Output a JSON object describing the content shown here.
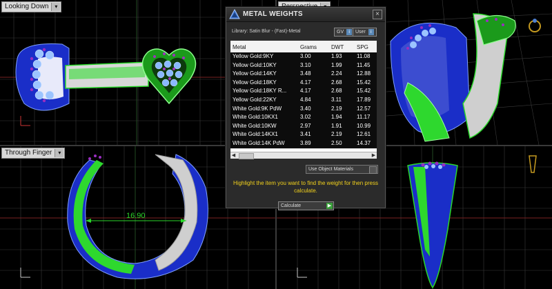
{
  "viewports": {
    "top_left": {
      "label": "Looking Down"
    },
    "top_right": {
      "label": "Perspective"
    },
    "bottom_left": {
      "label": "Through Finger",
      "dimension": "16.90"
    },
    "bottom_right": {
      "label": ""
    }
  },
  "dialog": {
    "title": "METAL WEIGHTS",
    "close": "×",
    "library": "Library: Satin Blur - (Fast)-Metal",
    "toggle_gv": "GV",
    "toggle_user": "User",
    "toggle_mark": "i",
    "columns": [
      "Metal",
      "Grams",
      "DWT",
      "SPG"
    ],
    "rows": [
      {
        "metal": "Yellow Gold:9KY",
        "grams": "3.00",
        "dwt": "1.93",
        "spg": "11.08",
        "selected": true
      },
      {
        "metal": "Yellow Gold:10KY",
        "grams": "3.10",
        "dwt": "1.99",
        "spg": "11.45",
        "selected": true
      },
      {
        "metal": "Yellow Gold:14KY",
        "grams": "3.48",
        "dwt": "2.24",
        "spg": "12.88",
        "selected": true
      },
      {
        "metal": "Yellow Gold:18KY",
        "grams": "4.17",
        "dwt": "2.68",
        "spg": "15.42",
        "selected": true
      },
      {
        "metal": "Yellow Gold:18KY R...",
        "grams": "4.17",
        "dwt": "2.68",
        "spg": "15.42",
        "selected": true
      },
      {
        "metal": "Yellow Gold:22KY",
        "grams": "4.84",
        "dwt": "3.11",
        "spg": "17.89",
        "selected": true
      },
      {
        "metal": "White Gold:9K PdW",
        "grams": "3.40",
        "dwt": "2.19",
        "spg": "12.57",
        "selected": true
      },
      {
        "metal": "White Gold:10KX1",
        "grams": "3.02",
        "dwt": "1.94",
        "spg": "11.17",
        "selected": true
      },
      {
        "metal": "White Gold:10KW",
        "grams": "2.97",
        "dwt": "1.91",
        "spg": "10.99",
        "selected": true
      },
      {
        "metal": "White Gold:14KX1",
        "grams": "3.41",
        "dwt": "2.19",
        "spg": "12.61",
        "selected": true
      },
      {
        "metal": "White Gold:14K PdW",
        "grams": "3.89",
        "dwt": "2.50",
        "spg": "14.37",
        "selected": true
      }
    ],
    "use_object_materials": "Use Object Materials",
    "hint": "Highlight the item you want to find the weight for then press calculate.",
    "calculate": "Calculate"
  }
}
